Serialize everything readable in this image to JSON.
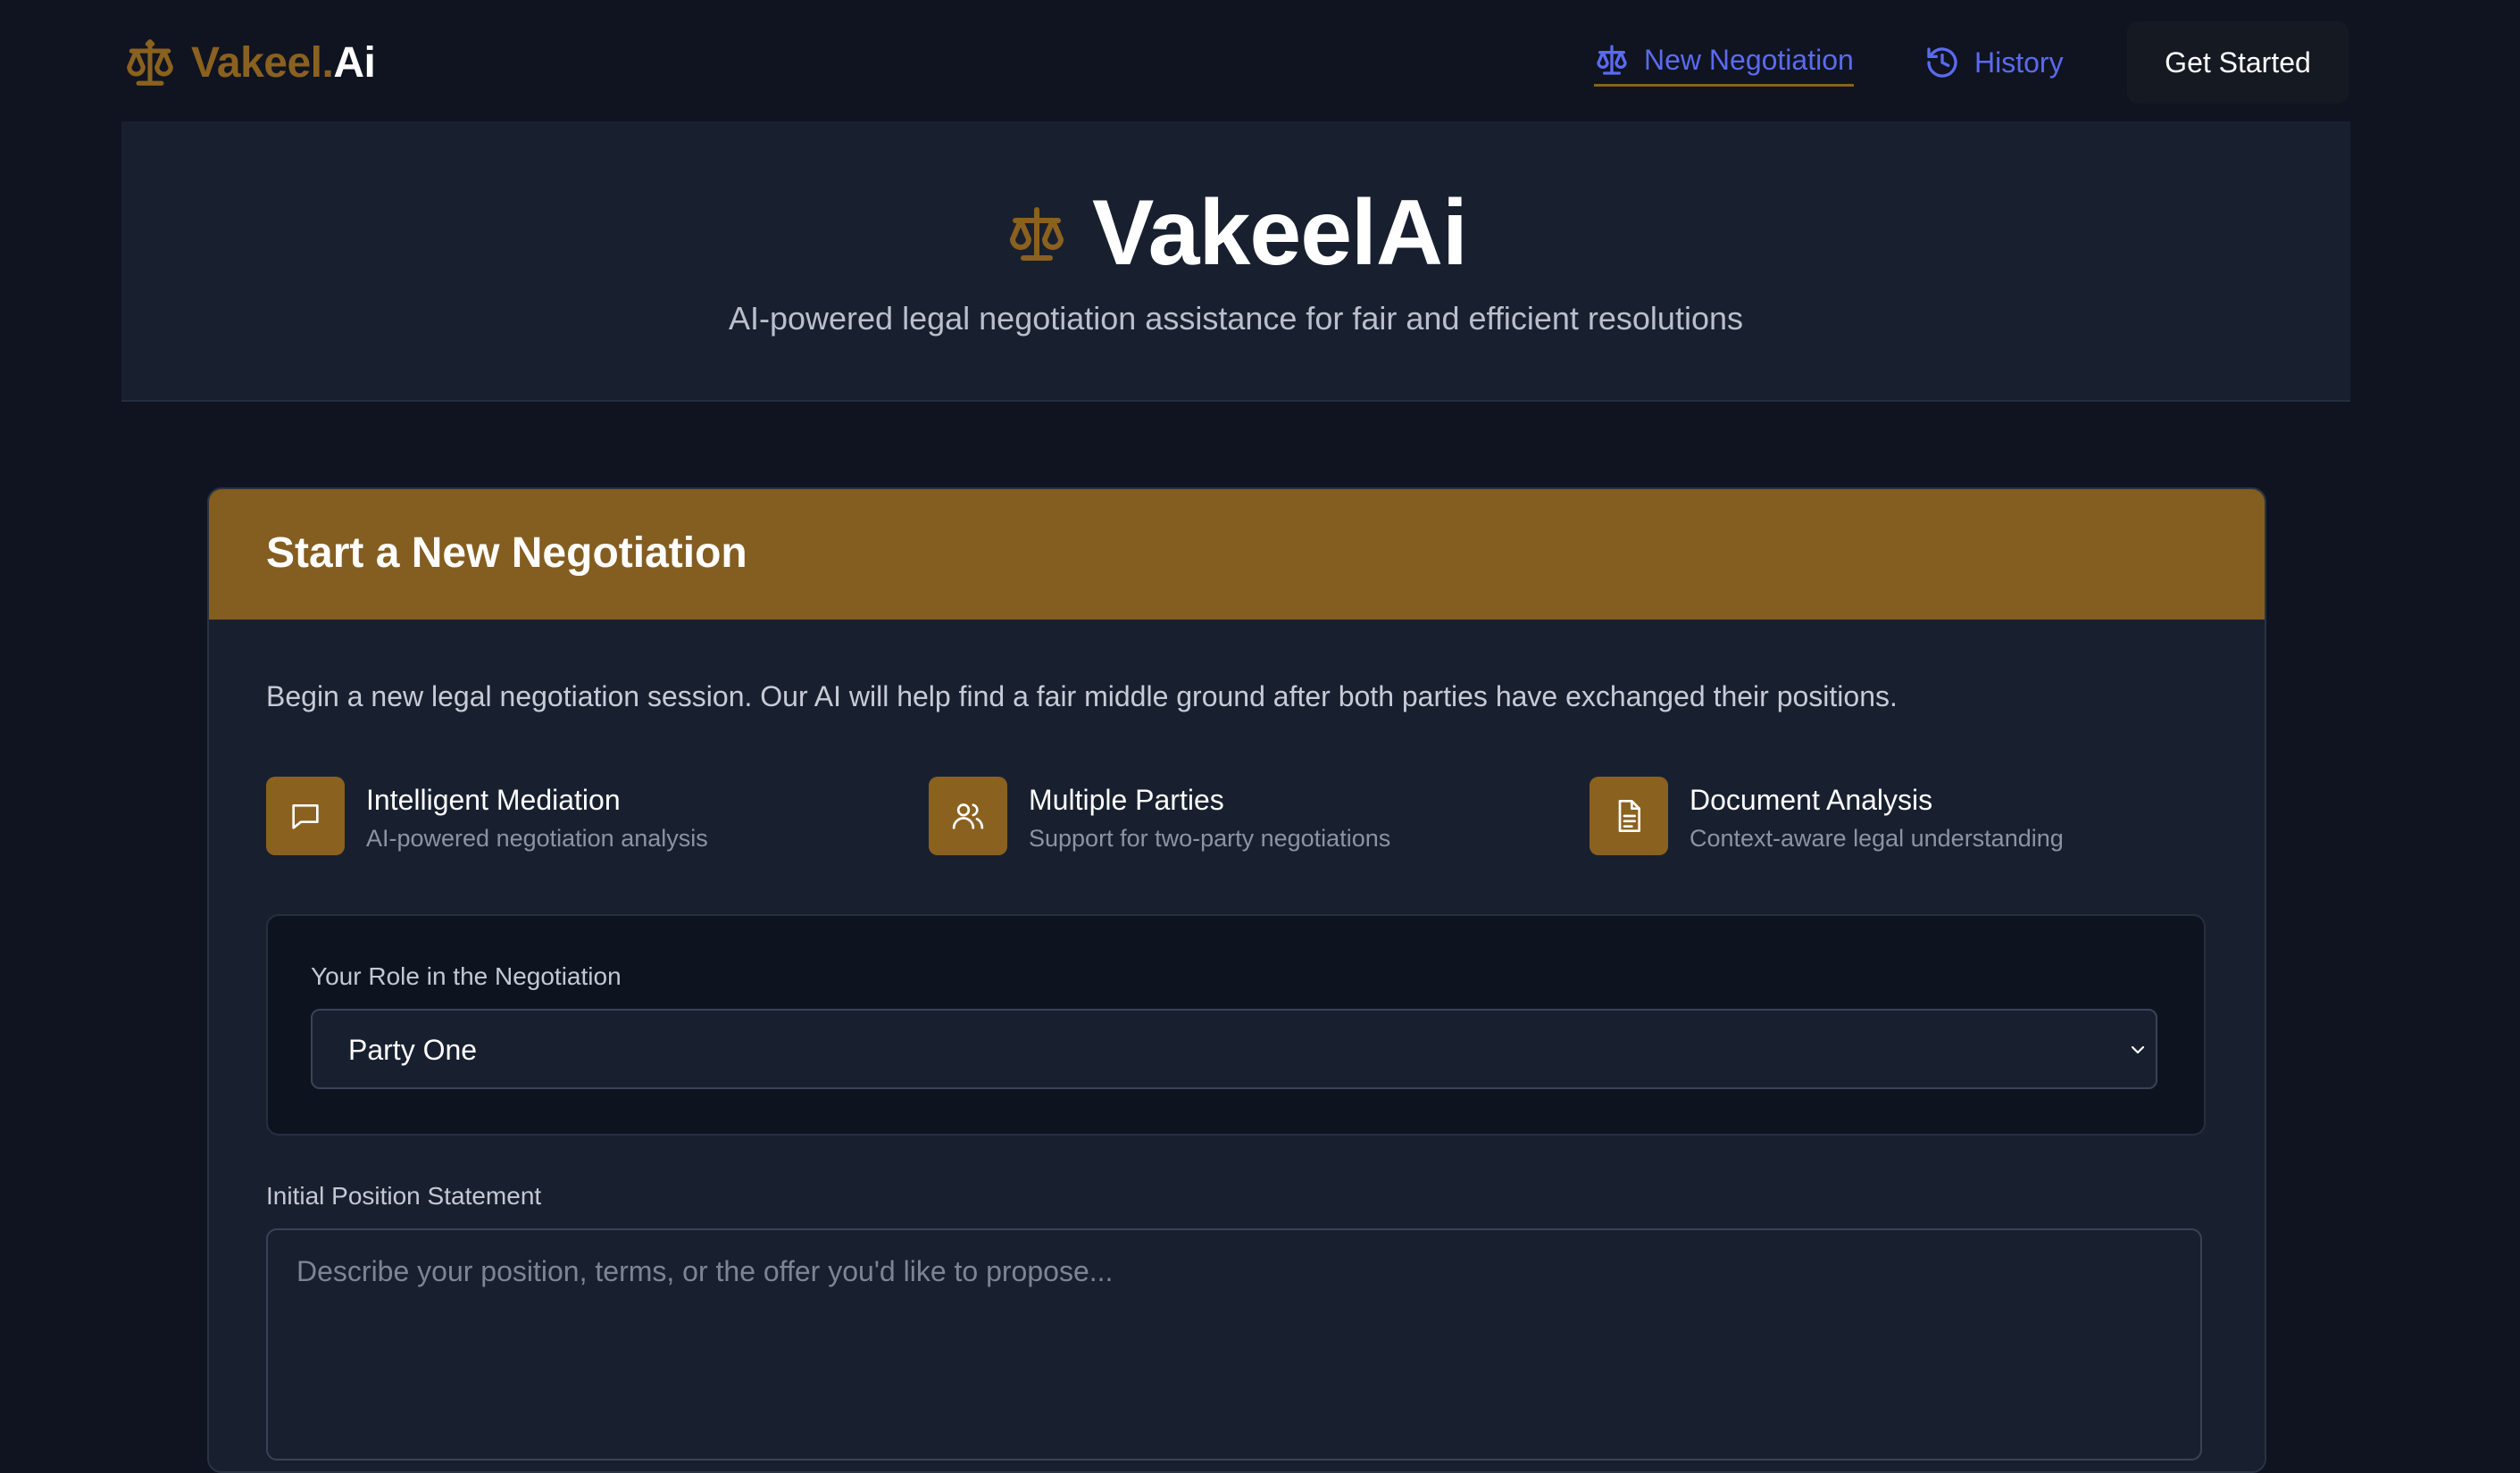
{
  "nav": {
    "brand": {
      "part1": "Vakeel.",
      "part2": "Ai",
      "icon": "scale-icon"
    },
    "links": [
      {
        "label": "New Negotiation",
        "icon": "scale-icon",
        "active": true
      },
      {
        "label": "History",
        "icon": "history-icon",
        "active": false
      }
    ],
    "cta_label": "Get Started"
  },
  "hero": {
    "title": "VakeelAi",
    "subtitle": "AI-powered legal negotiation assistance for fair and efficient resolutions",
    "icon": "scale-icon"
  },
  "card": {
    "title": "Start a New Negotiation",
    "intro": "Begin a new legal negotiation session. Our AI will help find a fair middle ground after both parties have exchanged their positions.",
    "features": [
      {
        "title": "Intelligent Mediation",
        "desc": "AI-powered negotiation analysis",
        "icon": "message-icon"
      },
      {
        "title": "Multiple Parties",
        "desc": "Support for two-party negotiations",
        "icon": "users-icon"
      },
      {
        "title": "Document Analysis",
        "desc": "Context-aware legal understanding",
        "icon": "document-icon"
      }
    ],
    "role": {
      "label": "Your Role in the Negotiation",
      "selected": "Party One"
    },
    "statement": {
      "label": "Initial Position Statement",
      "placeholder": "Describe your position, terms, or the offer you'd like to propose...",
      "value": ""
    }
  },
  "colors": {
    "background": "#0f1420",
    "panel": "#182030",
    "accent": "#845d20",
    "link": "#5b6af0"
  }
}
